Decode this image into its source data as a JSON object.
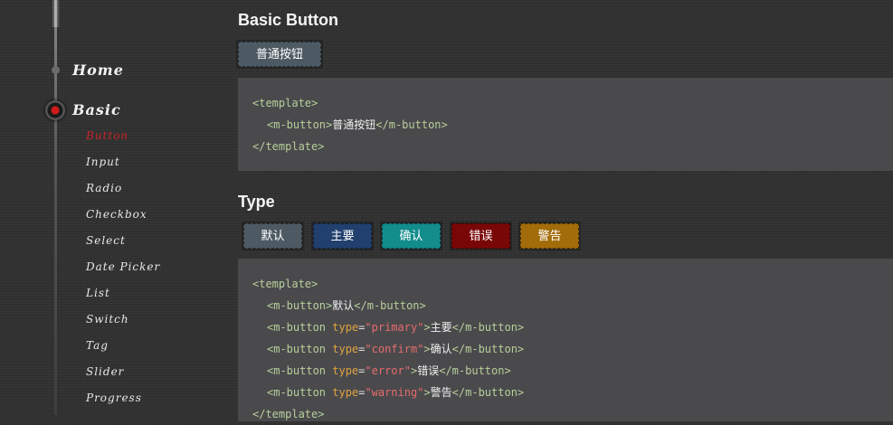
{
  "sidebar": {
    "home": "Home",
    "basic": "Basic",
    "items": [
      {
        "label": "Button",
        "active": true
      },
      {
        "label": "Input",
        "active": false
      },
      {
        "label": "Radio",
        "active": false
      },
      {
        "label": "Checkbox",
        "active": false
      },
      {
        "label": "Select",
        "active": false
      },
      {
        "label": "Date Picker",
        "active": false
      },
      {
        "label": "List",
        "active": false
      },
      {
        "label": "Switch",
        "active": false
      },
      {
        "label": "Tag",
        "active": false
      },
      {
        "label": "Slider",
        "active": false
      },
      {
        "label": "Progress",
        "active": false
      }
    ]
  },
  "basic_section": {
    "title": "Basic Button",
    "button_label": "普通按钮",
    "code": {
      "template_open": "<template>",
      "tag_open": "<m-button>",
      "text": "普通按钮",
      "tag_close": "</m-button>",
      "template_close": "</template>"
    }
  },
  "type_section": {
    "title": "Type",
    "buttons": {
      "default": "默认",
      "primary": "主要",
      "confirm": "确认",
      "error": "错误",
      "warning": "警告"
    },
    "code": {
      "template_open": "<template>",
      "l1_open": "<m-button>",
      "l1_text": "默认",
      "tag_start": "<m-button ",
      "attr": "type",
      "eq": "=",
      "v_primary": "\"primary\"",
      "v_confirm": "\"confirm\"",
      "v_error": "\"error\"",
      "v_warning": "\"warning\"",
      "gt": ">",
      "t_primary": "主要",
      "t_confirm": "确认",
      "t_error": "错误",
      "t_warning": "警告",
      "tag_close": "</m-button>",
      "template_close": "</template>"
    }
  },
  "colors": {
    "active_nav": "#c8242c",
    "btn_default": "#4e5a63",
    "btn_primary": "#22406e",
    "btn_confirm": "#138c8c",
    "btn_error": "#7a0707",
    "btn_warning": "#a36c0a"
  }
}
